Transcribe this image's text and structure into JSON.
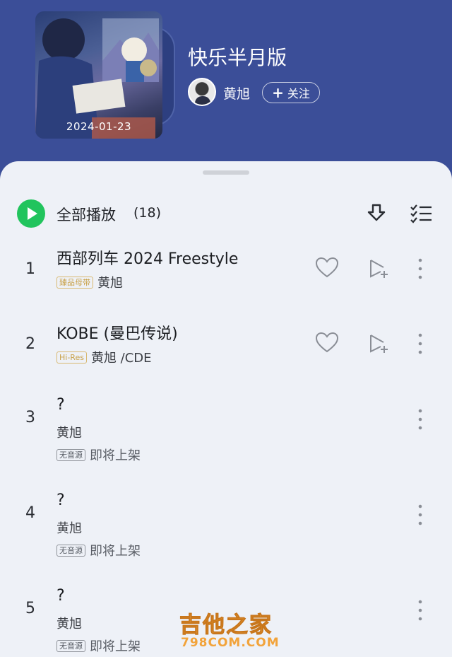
{
  "album": {
    "title": "快乐半月版",
    "date": "2024-01-23"
  },
  "artist": {
    "name": "黄旭",
    "follow_label": "关注"
  },
  "toolbar": {
    "play_all_label": "全部播放",
    "count": "(18)"
  },
  "songs": [
    {
      "num": "1",
      "title": "西部列车 2024 Freestyle",
      "tag": "臻品母带",
      "artists": "黄旭"
    },
    {
      "num": "2",
      "title": "KOBE (曼巴传说)",
      "tag": "Hi-Res",
      "artists": "黄旭 /CDE"
    },
    {
      "num": "3",
      "title": "?",
      "artists": "黄旭",
      "tag": "无音源",
      "status": "即将上架"
    },
    {
      "num": "4",
      "title": "?",
      "artists": "黄旭",
      "tag": "无音源",
      "status": "即将上架"
    },
    {
      "num": "5",
      "title": "?",
      "artists": "黄旭",
      "tag": "无音源",
      "status": "即将上架"
    }
  ],
  "watermark": {
    "line1": "吉他之家",
    "line2": "798COM.COM"
  },
  "colors": {
    "header_bg": "#3b4e98",
    "sheet_bg": "#eef1f7",
    "play_green": "#21c45d",
    "tag_gold": "#c9a24a"
  }
}
